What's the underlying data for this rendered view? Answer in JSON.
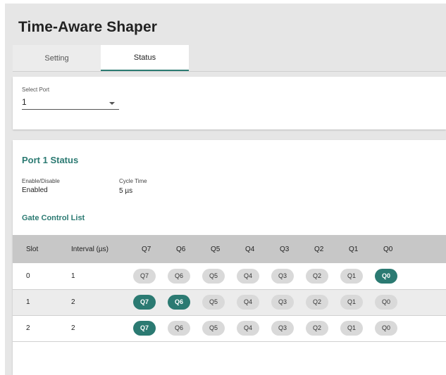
{
  "page": {
    "title": "Time-Aware Shaper"
  },
  "tabs": [
    {
      "label": "Setting",
      "active": false
    },
    {
      "label": "Status",
      "active": true
    }
  ],
  "select_port": {
    "label": "Select Port",
    "value": "1"
  },
  "status": {
    "title": "Port 1 Status",
    "enable_label": "Enable/Disable",
    "enable_value": "Enabled",
    "cycle_label": "Cycle Time",
    "cycle_value": "5 µs"
  },
  "gcl": {
    "title": "Gate Control List",
    "headers": [
      "Slot",
      "Interval (µs)",
      "Q7",
      "Q6",
      "Q5",
      "Q4",
      "Q3",
      "Q2",
      "Q1",
      "Q0"
    ],
    "rows": [
      {
        "slot": "0",
        "interval": "1",
        "open": [
          "Q0"
        ]
      },
      {
        "slot": "1",
        "interval": "2",
        "open": [
          "Q7",
          "Q6"
        ]
      },
      {
        "slot": "2",
        "interval": "2",
        "open": [
          "Q7"
        ]
      }
    ]
  },
  "queues": [
    "Q7",
    "Q6",
    "Q5",
    "Q4",
    "Q3",
    "Q2",
    "Q1",
    "Q0"
  ],
  "colors": {
    "accent": "#2b7a72",
    "pill_off": "#d9d9d9",
    "header_bg": "#c7c7c7"
  }
}
